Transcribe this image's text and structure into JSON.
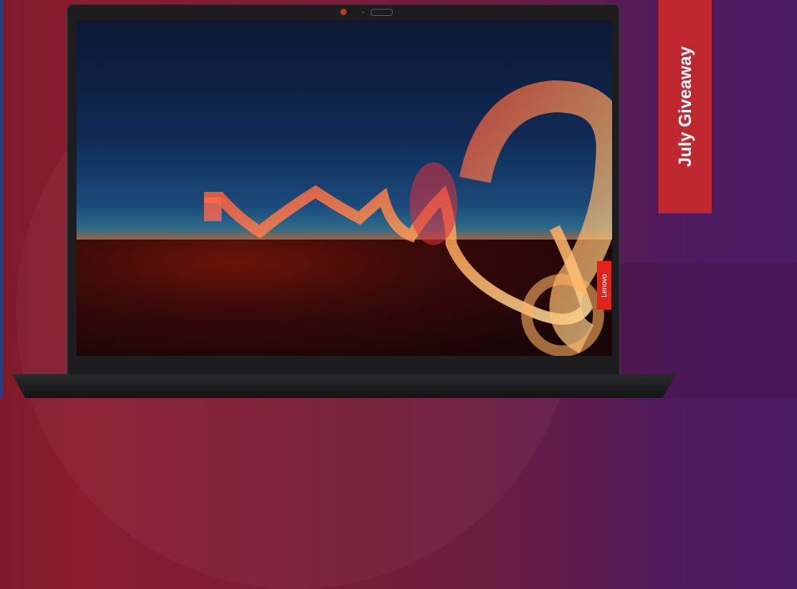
{
  "banner": {
    "text": "July Giveaway",
    "color": "#c0282f"
  },
  "laptop": {
    "brand_label": "Lenovo",
    "brand_color": "#e2231a"
  }
}
